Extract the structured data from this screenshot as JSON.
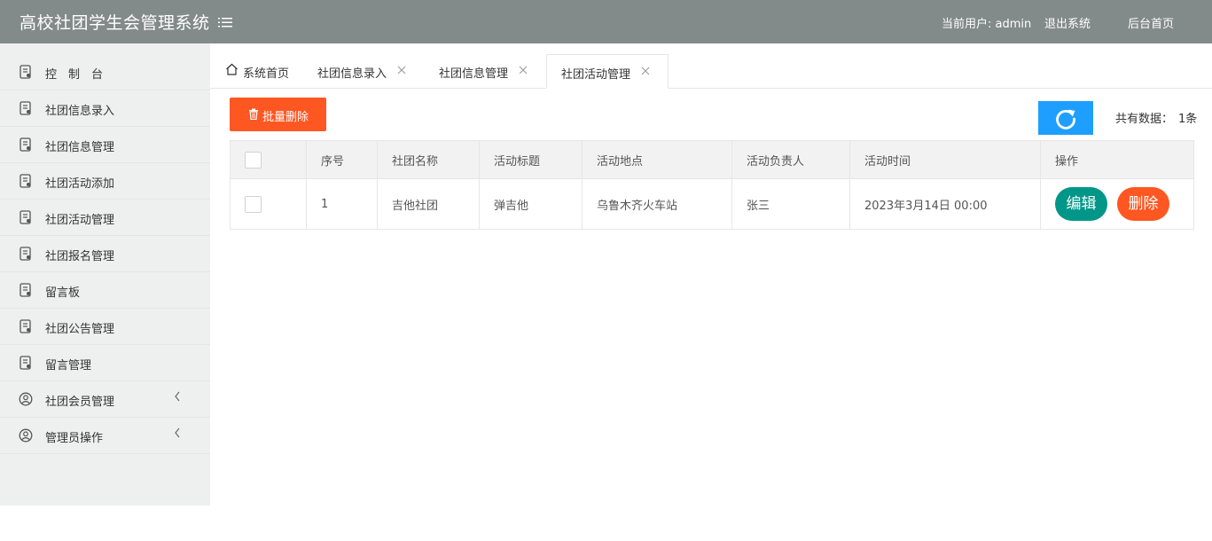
{
  "header": {
    "title": "高校社团学生会管理系统",
    "current_user": "当前用户: admin",
    "logout": "退出系统",
    "admin_home": "后台首页"
  },
  "sidebar": {
    "items": [
      {
        "label": "控　制　台",
        "icon": "document-icon"
      },
      {
        "label": "社团信息录入",
        "icon": "document-icon"
      },
      {
        "label": "社团信息管理",
        "icon": "document-icon"
      },
      {
        "label": "社团活动添加",
        "icon": "document-icon"
      },
      {
        "label": "社团活动管理",
        "icon": "document-icon"
      },
      {
        "label": "社团报名管理",
        "icon": "document-icon"
      },
      {
        "label": "留言板",
        "icon": "document-icon"
      },
      {
        "label": "社团公告管理",
        "icon": "document-icon"
      },
      {
        "label": "留言管理",
        "icon": "document-icon"
      },
      {
        "label": "社团会员管理",
        "icon": "user-circle-icon",
        "arrow": "chevron-left-icon"
      },
      {
        "label": "管理员操作",
        "icon": "user-circle-icon",
        "arrow": "chevron-left-icon"
      }
    ]
  },
  "tabs": [
    {
      "label": "系统首页",
      "icon": "home-icon"
    },
    {
      "label": "社团信息录入",
      "close": "close-icon"
    },
    {
      "label": "社团信息管理",
      "close": "close-icon"
    },
    {
      "label": "社团活动管理",
      "close": "close-icon",
      "active": true
    }
  ],
  "toolbar": {
    "batch_delete": "批量删除",
    "refresh_icon": "refresh-icon",
    "total_label": "共有数据：",
    "total_count": "1条"
  },
  "table": {
    "headers": [
      "",
      "序号",
      "社团名称",
      "活动标题",
      "活动地点",
      "活动负责人",
      "活动时间",
      "操作"
    ],
    "rows": [
      {
        "index": "1",
        "club": "吉他社团",
        "title": "弹吉他",
        "place": "乌鲁木齐火车站",
        "leader": "张三",
        "time": "2023年3月14日 00:00"
      }
    ],
    "edit_label": "编辑",
    "delete_label": "删除"
  },
  "colors": {
    "header_bg": "#838a8a",
    "sidebar_bg": "#eef0ef",
    "danger": "#ff5722",
    "primary": "#009688",
    "refresh": "#1e9fff"
  }
}
